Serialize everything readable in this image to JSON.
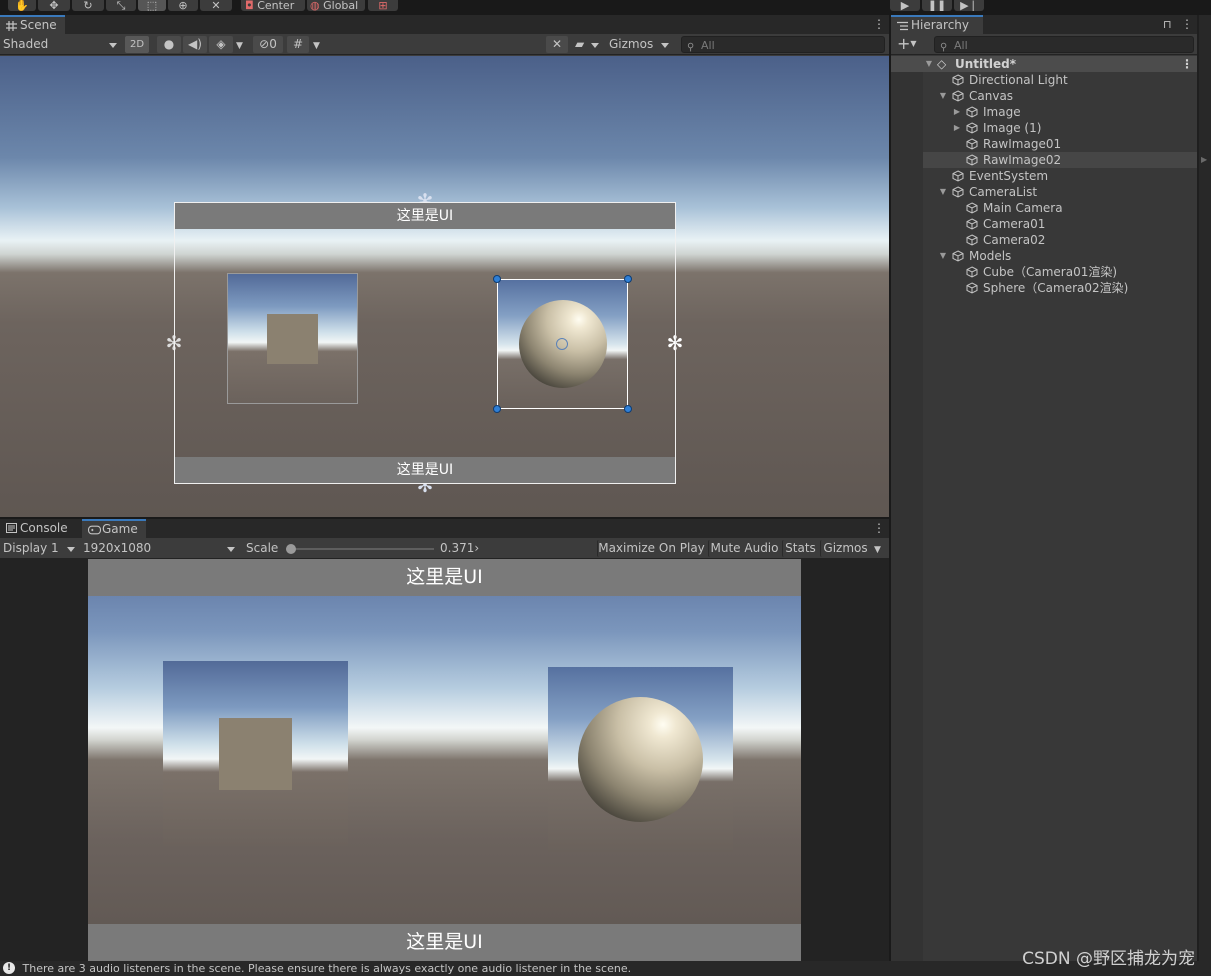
{
  "toolbar": {
    "pivot_label": "Center",
    "space_label": "Global"
  },
  "scene": {
    "tab_label": "Scene",
    "shading_mode": "Shaded",
    "mode_2d_label": "2D",
    "hidden_count": "0",
    "gizmos_label": "Gizmos",
    "search_placeholder": "All",
    "ui_top_text": "这里是UI",
    "ui_bottom_text": "这里是UI"
  },
  "game": {
    "console_tab_label": "Console",
    "game_tab_label": "Game",
    "display_label": "Display 1",
    "resolution_label": "1920x1080",
    "scale_label": "Scale",
    "scale_value": "0.371›",
    "scale_level": 0.0,
    "maximize_label": "Maximize On Play",
    "mute_label": "Mute Audio",
    "stats_label": "Stats",
    "gizmos_label": "Gizmos",
    "ui_top_text": "这里是UI",
    "ui_bottom_text": "这里是UI"
  },
  "hierarchy": {
    "tab_label": "Hierarchy",
    "search_placeholder": "All",
    "scene_name": "Untitled*",
    "items": [
      {
        "label": "Directional Light"
      },
      {
        "label": "Canvas"
      },
      {
        "label": "Image"
      },
      {
        "label": "Image (1)"
      },
      {
        "label": "RawImage01"
      },
      {
        "label": "RawImage02"
      },
      {
        "label": "EventSystem"
      },
      {
        "label": "CameraList"
      },
      {
        "label": "Main Camera"
      },
      {
        "label": "Camera01"
      },
      {
        "label": "Camera02"
      },
      {
        "label": "Models"
      },
      {
        "label": "Cube（Camera01渲染)"
      },
      {
        "label": "Sphere（Camera02渲染)"
      }
    ]
  },
  "status": {
    "message": "There are 3 audio listeners in the scene. Please ensure there is always exactly one audio listener in the scene."
  },
  "watermark": "CSDN @野区捕龙为宠",
  "colors": {
    "selection_accent": "#3a79bb",
    "handle_blue": "#2f7fd6"
  }
}
